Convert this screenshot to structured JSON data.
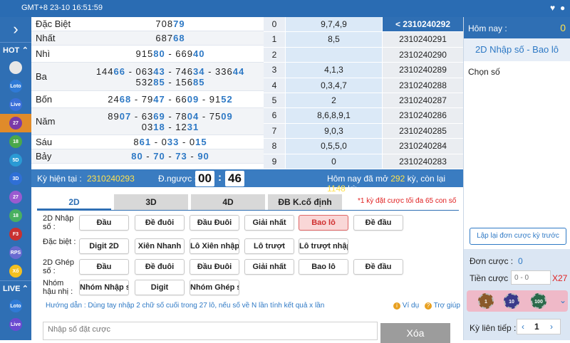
{
  "topbar": {
    "clock": "GMT+8 23-10 16:51:59"
  },
  "leftnav": {
    "hot_label": "HOT",
    "live_label": "LIVE",
    "icons": [
      {
        "name": "lotto-balls-icon",
        "text": "",
        "color": "#e7e7e7"
      },
      {
        "name": "loto-icon",
        "text": "Loto",
        "color": "#2f7ad6"
      },
      {
        "name": "live-icon",
        "text": "Live",
        "color": "#3a6fd9"
      },
      {
        "name": "27-icon",
        "text": "27",
        "color": "#7a3aa8"
      },
      {
        "name": "18-icon",
        "text": "18",
        "color": "#4aa84a"
      },
      {
        "name": "5d-icon",
        "text": "5D",
        "color": "#2a9ad4"
      },
      {
        "name": "3d-icon",
        "text": "3D",
        "color": "#2f6fd6"
      },
      {
        "name": "27-icon-2",
        "text": "27",
        "color": "#9a5ad0"
      },
      {
        "name": "18-icon-2",
        "text": "18",
        "color": "#48b060"
      },
      {
        "name": "f3-icon",
        "text": "F3",
        "color": "#c83030"
      },
      {
        "name": "rps-icon",
        "text": "RPS",
        "color": "#6a6ad0"
      },
      {
        "name": "xoso-icon",
        "text": "Xổ",
        "color": "#f2c020"
      }
    ],
    "live_icons": [
      {
        "name": "loto-live-icon",
        "text": "Loto",
        "color": "#2f7ad6"
      },
      {
        "name": "live-live-icon",
        "text": "Live",
        "color": "#6a4ad0"
      }
    ]
  },
  "results": [
    {
      "label": "Đặc Biệt",
      "lines": [
        [
          {
            "p": "708",
            "h": "79"
          }
        ]
      ]
    },
    {
      "label": "Nhất",
      "lines": [
        [
          {
            "p": "687",
            "h": "68"
          }
        ]
      ]
    },
    {
      "label": "Nhì",
      "lines": [
        [
          {
            "p": "915",
            "h": "80"
          },
          {
            "p": "669",
            "h": "40"
          }
        ]
      ]
    },
    {
      "label": "Ba",
      "lines": [
        [
          {
            "p": "144",
            "h": "66"
          },
          {
            "p": "063",
            "h": "43"
          },
          {
            "p": "746",
            "h": "34"
          },
          {
            "p": "336",
            "h": "44"
          }
        ],
        [
          {
            "p": "532",
            "h": "85"
          },
          {
            "p": "156",
            "h": "85"
          }
        ]
      ]
    },
    {
      "label": "Bốn",
      "lines": [
        [
          {
            "p": "24",
            "h": "68"
          },
          {
            "p": "79",
            "h": "47"
          },
          {
            "p": "66",
            "h": "09"
          },
          {
            "p": "91",
            "h": "52"
          }
        ]
      ]
    },
    {
      "label": "Năm",
      "lines": [
        [
          {
            "p": "89",
            "h": "07"
          },
          {
            "p": "63",
            "h": "69"
          },
          {
            "p": "78",
            "h": "04"
          },
          {
            "p": "75",
            "h": "09"
          }
        ],
        [
          {
            "p": "03",
            "h": "18"
          },
          {
            "p": "12",
            "h": "31"
          }
        ]
      ]
    },
    {
      "label": "Sáu",
      "lines": [
        [
          {
            "p": "8",
            "h": "61"
          },
          {
            "p": "0",
            "h": "33"
          },
          {
            "p": "0",
            "h": "15"
          }
        ]
      ]
    },
    {
      "label": "Bảy",
      "lines": [
        [
          {
            "p": "",
            "h": "80"
          },
          {
            "p": "",
            "h": "70"
          },
          {
            "p": "",
            "h": "73"
          },
          {
            "p": "",
            "h": "90"
          }
        ]
      ]
    }
  ],
  "tails": [
    {
      "d": "0",
      "t": "9,7,4,9",
      "k": "< 2310240292",
      "sel": true
    },
    {
      "d": "1",
      "t": "8,5",
      "k": "2310240291"
    },
    {
      "d": "2",
      "t": "",
      "k": "2310240290"
    },
    {
      "d": "3",
      "t": "4,1,3",
      "k": "2310240289"
    },
    {
      "d": "4",
      "t": "0,3,4,7",
      "k": "2310240288"
    },
    {
      "d": "5",
      "t": "2",
      "k": "2310240287"
    },
    {
      "d": "6",
      "t": "8,6,8,9,1",
      "k": "2310240286"
    },
    {
      "d": "7",
      "t": "9,0,3",
      "k": "2310240285"
    },
    {
      "d": "8",
      "t": "0,5,5,0",
      "k": "2310240284"
    },
    {
      "d": "9",
      "t": "0",
      "k": "2310240283"
    }
  ],
  "status": {
    "label": "Kỳ hiện tại :",
    "period": "2310240293",
    "countdown_label": "Đ.ngược :",
    "mm": "00",
    "ss": "46",
    "info_pre": "Hôm nay đã mở",
    "info_open": "292",
    "info_mid": "kỳ, còn lại",
    "info_left": "1148",
    "info_post": "kỳ"
  },
  "tabs": [
    "2D",
    "3D",
    "4D",
    "ĐB K.cố định"
  ],
  "tab_note": "*1 kỳ đặt cược tối đa 65 con số",
  "groups": [
    {
      "label": "2D Nhập số :",
      "buttons": [
        "Đầu",
        "Đề đuôi",
        "Đầu Đuôi",
        "Giải nhất",
        "Bao lô",
        "Đề đầu"
      ]
    },
    {
      "label": "Đặc biệt :",
      "buttons": [
        "Digit 2D",
        "Xiên Nhanh",
        "Lô Xiên nhập số",
        "Lô trượt",
        "Lô trượt nhập số"
      ]
    },
    {
      "label": "2D Ghép số :",
      "buttons": [
        "Đầu",
        "Đề đuôi",
        "Đầu Đuôi",
        "Giải nhất",
        "Bao lô",
        "Đề đầu"
      ]
    },
    {
      "label": "Nhóm hậu nhị :",
      "buttons": [
        "Nhóm Nhập số",
        "Digit",
        "Nhóm Ghép số"
      ]
    }
  ],
  "guide": "Hướng dẫn : Dùng tay nhập 2 chữ số cuối trong 27 lô, nếu số về N lần tính kết quả x lần",
  "example_label": "Ví dụ",
  "help_label": "Trợ giúp",
  "input_placeholder": "Nhập số đặt cược",
  "clear_label": "Xóa",
  "right": {
    "today_label": "Hôm nay :",
    "today_value": "0",
    "mode_title": "2D Nhập số - Bao lô",
    "choose_label": "Chọn số",
    "repeat_label": "Lập lại đơn cược kỳ trước",
    "bet_label": "Đơn cược :",
    "bet_value": "0",
    "money_label": "Tiền cược :",
    "money_placeholder": "0 - 0",
    "multiplier": "X27",
    "chips": [
      "1",
      "10",
      "100"
    ],
    "consecutive_label": "Kỳ liên tiếp :",
    "consecutive_value": "1"
  },
  "colors": {
    "primary": "#2f6fb4",
    "highlight": "#2e79c5",
    "selected_bg": "#f9d7d7",
    "selected_text": "#d03030"
  }
}
